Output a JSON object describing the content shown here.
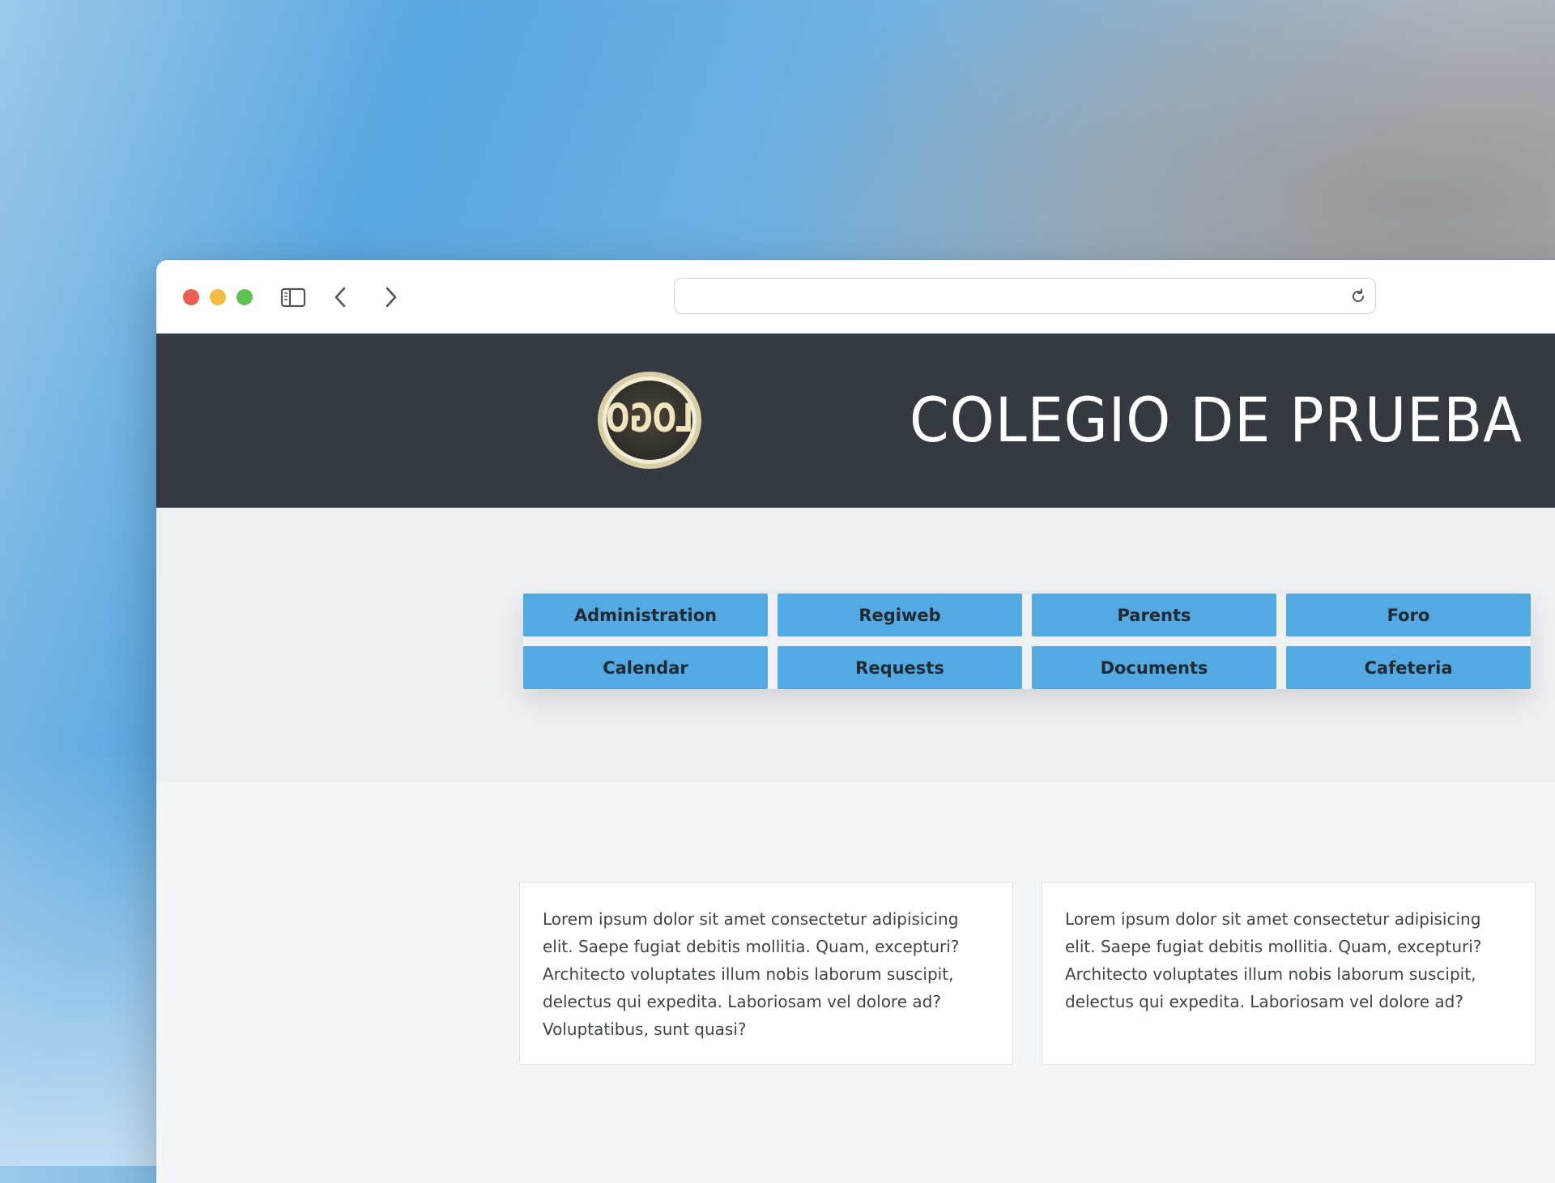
{
  "browser": {
    "url": "",
    "icons": [
      "sidebar-icon",
      "back-icon",
      "forward-icon",
      "reload-icon"
    ]
  },
  "header": {
    "logo_text": "LOGO",
    "title": "COLEGIO DE PRUEBA"
  },
  "nav": {
    "buttons": [
      {
        "label": "Administration"
      },
      {
        "label": "Regiweb"
      },
      {
        "label": "Parents"
      },
      {
        "label": "Foro"
      },
      {
        "label": "Calendar"
      },
      {
        "label": "Requests"
      },
      {
        "label": "Documents"
      },
      {
        "label": "Cafeteria"
      }
    ]
  },
  "cards": [
    {
      "text": "Lorem ipsum dolor sit amet consectetur adipisicing elit. Saepe fugiat debitis mollitia. Quam, excepturi? Architecto voluptates illum nobis laborum suscipit, delectus qui expedita. Laboriosam vel dolore ad? Voluptatibus, sunt quasi?"
    },
    {
      "text": "Lorem ipsum dolor sit amet consectetur adipisicing elit. Saepe fugiat debitis mollitia. Quam, excepturi? Architecto voluptates illum nobis laborum suscipit, delectus qui expedita. Laboriosam vel dolore ad?"
    }
  ],
  "colors": {
    "header_bg": "#353a40",
    "button_bg": "#55a9e2",
    "page_bg": "#eff0f2"
  }
}
